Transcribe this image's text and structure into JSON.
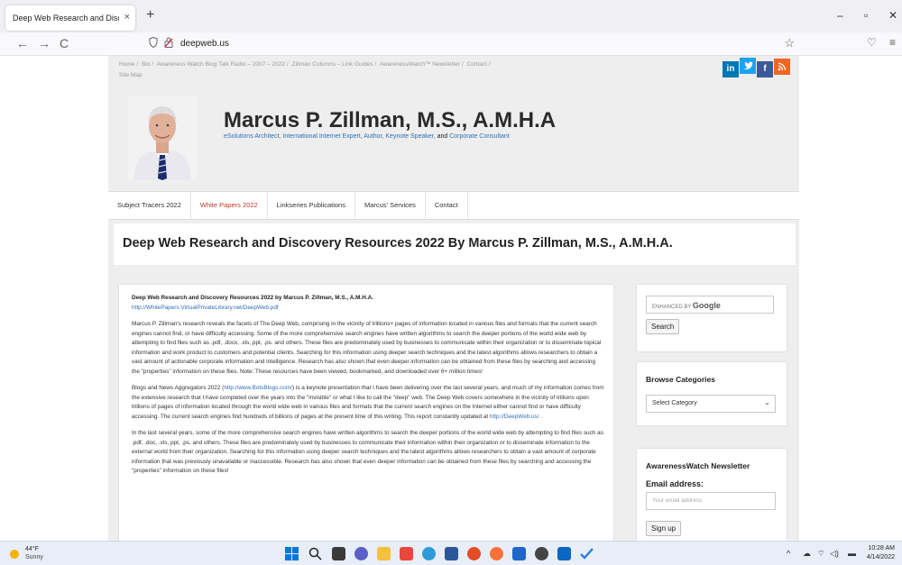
{
  "browser": {
    "tab_title": "Deep Web Research and Discovery",
    "tab_close": "×",
    "new_tab": "+",
    "url": "deepweb.us",
    "window_controls": {
      "minimize": "–",
      "restore": "▫",
      "close": "✕"
    },
    "nav": {
      "back": "←",
      "forward": "→",
      "reload": "C"
    },
    "star": "☆",
    "pocket": "♡",
    "menu": "≡"
  },
  "site": {
    "breadcrumb": [
      "Home",
      "/",
      "Bio",
      "/",
      "Awareness Watch Blog Talk Radio – 2007 – 2022",
      "/",
      "Zillman Columns – Link Guides",
      "/",
      "AwarenessWatch™ Newsletter",
      "/",
      "Contact",
      "/"
    ],
    "breadcrumb_line2": "Site Map",
    "social": {
      "linkedin": "in",
      "twitter": "🐦",
      "facebook": "f",
      "rss": "⟆"
    },
    "colors": {
      "linkedin": "#0077b5",
      "twitter": "#1da1f2",
      "facebook": "#3b5998",
      "rss": "#f26522",
      "link": "#2e6fb5",
      "active_menu": "#c0392b"
    },
    "title": "Marcus P. Zillman, M.S., A.M.H.A",
    "tagline_parts": [
      "eSolutions Architect, International Internet Expert, Author, Keynote Speaker,",
      " and ",
      "Corporate Consultant"
    ],
    "menu": [
      "Subject Tracers 2022",
      "White Papers 2022",
      "Linkseries Publications",
      "Marcus' Services",
      "Contact"
    ],
    "page_title": "Deep Web Research and Discovery Resources 2022 By Marcus P. Zillman, M.S., A.M.H.A."
  },
  "article": {
    "heading": "Deep Web Research and Discovery Resources 2022 by Marcus P. Zillman, M.S., A.M.H.A.",
    "link": "http://WhitePapers.VirtualPrivateLibrary.net/DeepWeb.pdf",
    "p1": "Marcus P. Zillman's research reveals the facets of The Deep Web, comprising in the vicinity of  trillions+ pages of information located in various files and formats that the current search engines cannot find, or have difficulty accessing. Some of the more comprehensive search engines have written algorithms to search the deeper portions of the world wide web by attempting to find files such as .pdf, .docx, .xls, ppt, .ps. and others. These files are predominately used by businesses to communicate within their organization or to disseminate topical information and work product to customers and potential clients. Searching for this information using deeper search techniques and the latest algorithms allows researchers to obtain a vast amount of actionable corporate information and intelligence. Research has also shown that even deeper information can be obtained from these files by searching and accessing the \"properties\" information on these files. Note: These resources have been viewed, bookmarked, and downloaded over 6+ million times!",
    "p2_a": "Blogs and News Aggregators 2022 (",
    "p2_link": "http://www.BotsBlogs.com/",
    "p2_b": ") is a keynote presentation that I have been delivering over the last several years, and much of my information comes from the extensive research that I have completed over the years into the \"invisible\" or what I like to call the \"deep\" web. The Deep Web covers somewhere in the vicinity of trillions upon trillions of pages of information located through the world wide web in various files and formats that the current search engines on the Internet either cannot find or have difficulty accessing. The current search engines find hundreds of billions of pages at the present time of this writing. This report constantly updated at ",
    "p2_link2": "http://DeepWeb.us/",
    "p2_c": " .",
    "p3": "In the last several years, some of the more comprehensive search engines have written algorithms to search the deeper portions of the world wide web by attempting to find files such as .pdf, .doc, .xls, ppt, .ps. and others. These files are predominately used by businesses to communicate their information within their organization or to disseminate information to the external world from their organization. Searching for this information using deeper search techniques and the latest algorithms allows researchers to obtain a vast amount of corporate information that was previously unavailable or inaccessible. Research has also shown that even deeper information can be obtained from these files by searching and accessing the \"properties\" information on these files!"
  },
  "sidebar": {
    "search_prefix": "ENHANCED BY",
    "search_brand": "Google",
    "search_button": "Search",
    "browse_title": "Browse Categories",
    "select_value": "Select Category",
    "newsletter_title": "AwarenessWatch Newsletter",
    "email_label": "Email address:",
    "email_placeholder": "Your email address",
    "signup_button": "Sign up"
  },
  "taskbar": {
    "temp": "44°F",
    "condition": "Sunny",
    "time": "10:28 AM",
    "date": "4/14/2022",
    "tray_up": "^",
    "tray_icons": [
      "☁",
      "⌔",
      "◁)",
      "▬"
    ]
  }
}
